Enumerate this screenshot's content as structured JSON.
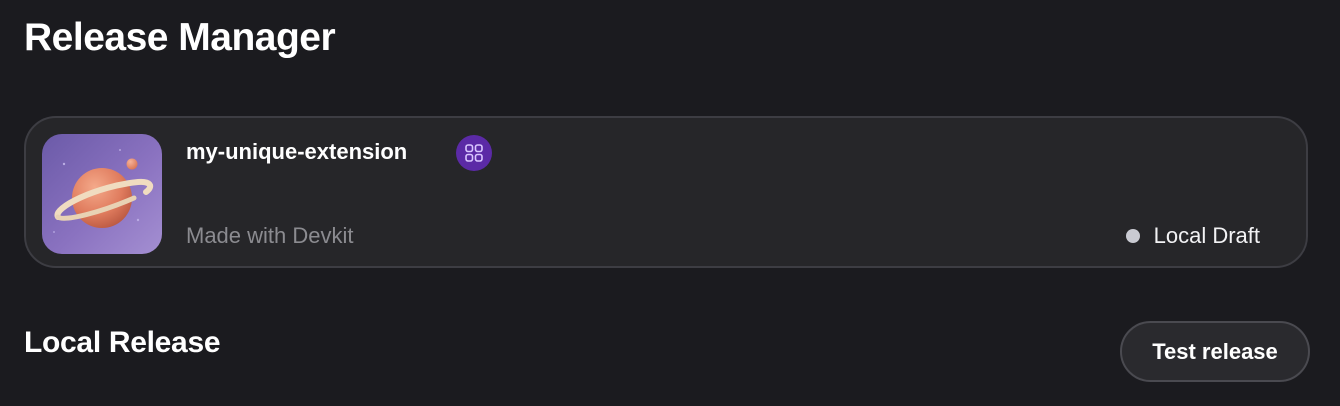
{
  "page": {
    "title": "Release Manager"
  },
  "extension": {
    "name": "my-unique-extension",
    "subtitle": "Made with Devkit",
    "thumbnail_icon": "planet-icon",
    "badge_icon": "devkit-grid-icon",
    "badge_color": "#5b2aa6",
    "status": {
      "label": "Local Draft",
      "dot_color": "#c9cad2"
    }
  },
  "local_release": {
    "heading": "Local Release",
    "test_button_label": "Test release"
  },
  "colors": {
    "background": "#1b1b1f",
    "card_background": "#262629",
    "card_border": "#3d3d43",
    "muted_text": "#8b8b90"
  }
}
